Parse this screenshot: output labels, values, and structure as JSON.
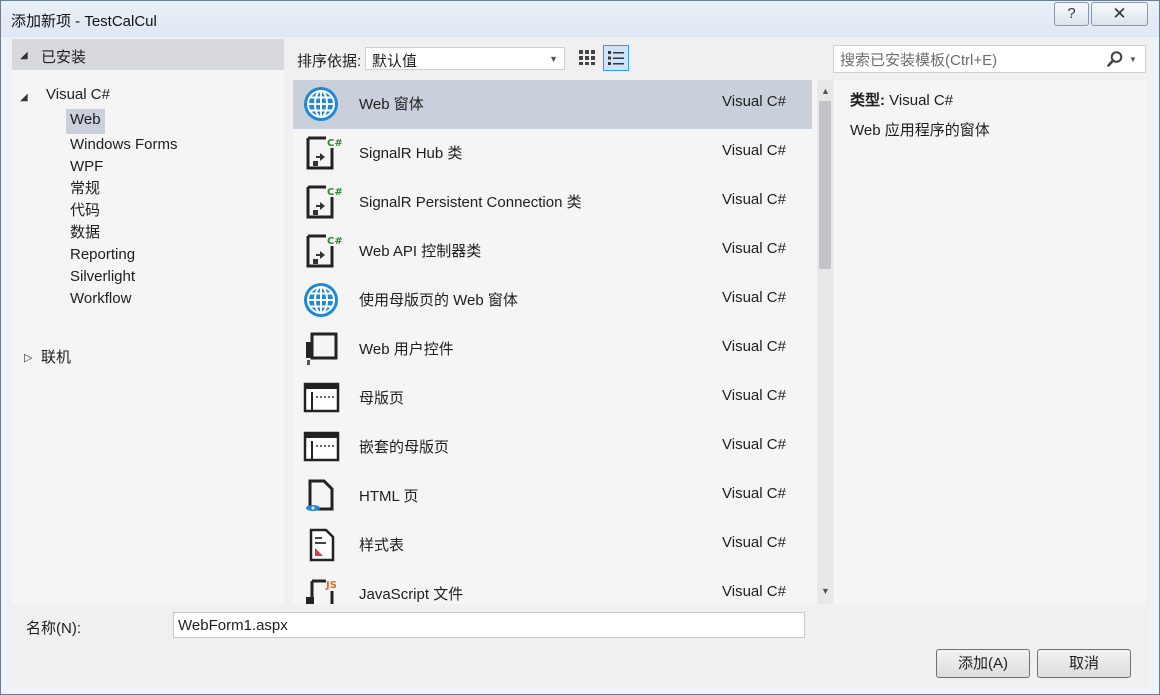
{
  "window": {
    "title": "添加新项 - TestCalCul",
    "help_glyph": "?",
    "close_glyph": "✕"
  },
  "tree": {
    "installed_label": "已安装",
    "root_label": "Visual C#",
    "items": [
      "Web",
      "Windows Forms",
      "WPF",
      "常规",
      "代码",
      "数据",
      "Reporting",
      "Silverlight",
      "Workflow"
    ],
    "selected_index": 0,
    "online_label": "联机"
  },
  "toolbar": {
    "sort_label": "排序依据:",
    "sort_value": "默认值"
  },
  "search": {
    "placeholder": "搜索已安装模板(Ctrl+E)"
  },
  "templates": [
    {
      "name": "Web 窗体",
      "lang": "Visual C#",
      "icon": "globe-icon"
    },
    {
      "name": "SignalR Hub 类",
      "lang": "Visual C#",
      "icon": "csharp-file-icon"
    },
    {
      "name": "SignalR Persistent Connection 类",
      "lang": "Visual C#",
      "icon": "csharp-file-icon"
    },
    {
      "name": "Web API 控制器类",
      "lang": "Visual C#",
      "icon": "csharp-file-icon"
    },
    {
      "name": "使用母版页的 Web 窗体",
      "lang": "Visual C#",
      "icon": "globe-icon"
    },
    {
      "name": "Web 用户控件",
      "lang": "Visual C#",
      "icon": "user-control-icon"
    },
    {
      "name": "母版页",
      "lang": "Visual C#",
      "icon": "master-page-icon"
    },
    {
      "name": "嵌套的母版页",
      "lang": "Visual C#",
      "icon": "master-page-icon"
    },
    {
      "name": "HTML 页",
      "lang": "Visual C#",
      "icon": "html-page-icon"
    },
    {
      "name": "样式表",
      "lang": "Visual C#",
      "icon": "stylesheet-icon"
    },
    {
      "name": "JavaScript 文件",
      "lang": "Visual C#",
      "icon": "javascript-file-icon"
    }
  ],
  "details": {
    "type_key": "类型:",
    "type_value": "Visual C#",
    "description": "Web 应用程序的窗体"
  },
  "name_field": {
    "label": "名称(N):",
    "value": "WebForm1.aspx"
  },
  "buttons": {
    "add": "添加(A)",
    "cancel": "取消"
  }
}
